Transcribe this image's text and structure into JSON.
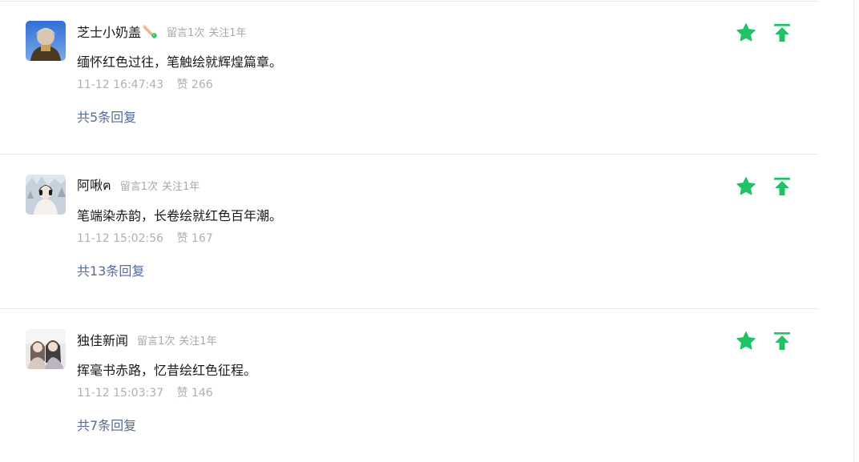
{
  "colors": {
    "accent_green": "#1fc366",
    "reply_link": "#576b95",
    "meta_gray": "#a8a8a8",
    "divider": "#e6e6e6"
  },
  "comments": [
    {
      "nickname": "芝士小奶盖",
      "emoji_icon": "carrot-emoji-icon",
      "tag1": "留言1次",
      "tag2": "关注1年",
      "content": "缅怀红色过往，笔触绘就辉煌篇章。",
      "timestamp": "11-12 16:47:43",
      "likes": "赞 266",
      "replies": "共5条回复"
    },
    {
      "nickname": "阿啾ฅ",
      "emoji_icon": "",
      "tag1": "留言1次",
      "tag2": "关注1年",
      "content": "笔端染赤韵，长卷绘就红色百年潮。",
      "timestamp": "11-12 15:02:56",
      "likes": "赞 167",
      "replies": "共13条回复"
    },
    {
      "nickname": "独佳新闻",
      "emoji_icon": "",
      "tag1": "留言1次",
      "tag2": "关注1年",
      "content": "挥毫书赤路，忆昔绘红色征程。",
      "timestamp": "11-12 15:03:37",
      "likes": "赞 146",
      "replies": "共7条回复"
    }
  ],
  "actions": {
    "star_icon": "star-icon",
    "pin_top_icon": "pin-to-top-icon"
  }
}
